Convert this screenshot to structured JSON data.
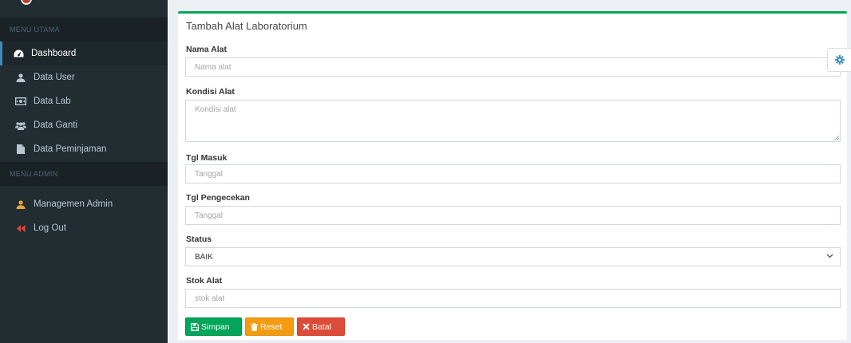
{
  "sidebar": {
    "header_main": "MENU UTAMA",
    "items_main": [
      {
        "label": "Dashboard",
        "icon": "dashboard-icon",
        "active": true
      },
      {
        "label": "Data User",
        "icon": "user-icon"
      },
      {
        "label": "Data Lab",
        "icon": "money-icon"
      },
      {
        "label": "Data Ganti",
        "icon": "users-icon"
      },
      {
        "label": "Data Peminjaman",
        "icon": "file-icon"
      }
    ],
    "header_admin": "MENU ADMIN",
    "items_admin": [
      {
        "label": "Managemen Admin",
        "icon": "admin-user-icon"
      },
      {
        "label": "Log Out",
        "icon": "backward-icon"
      }
    ]
  },
  "form": {
    "title": "Tambah Alat Laboratorium",
    "nama_alat": {
      "label": "Nama Alat",
      "placeholder": "Nama alat",
      "value": ""
    },
    "kondisi_alat": {
      "label": "Kondisi Alat",
      "placeholder": "Kondisi alat",
      "value": ""
    },
    "tgl_masuk": {
      "label": "Tgl Masuk",
      "placeholder": "Tanggal",
      "value": ""
    },
    "tgl_pengecekan": {
      "label": "Tgl Pengecekan",
      "placeholder": "Tanggal",
      "value": ""
    },
    "status": {
      "label": "Status",
      "value": "BAIK"
    },
    "stok_alat": {
      "label": "Stok Alat",
      "placeholder": "stok alat",
      "value": ""
    },
    "buttons": {
      "simpan": "Simpan",
      "reset": "Reset",
      "batal": "Batal"
    }
  },
  "colors": {
    "sidebar_bg": "#222d32",
    "accent": "#3c8dbc",
    "success": "#00a65a",
    "warning": "#f39c12",
    "danger": "#dd4b39"
  }
}
